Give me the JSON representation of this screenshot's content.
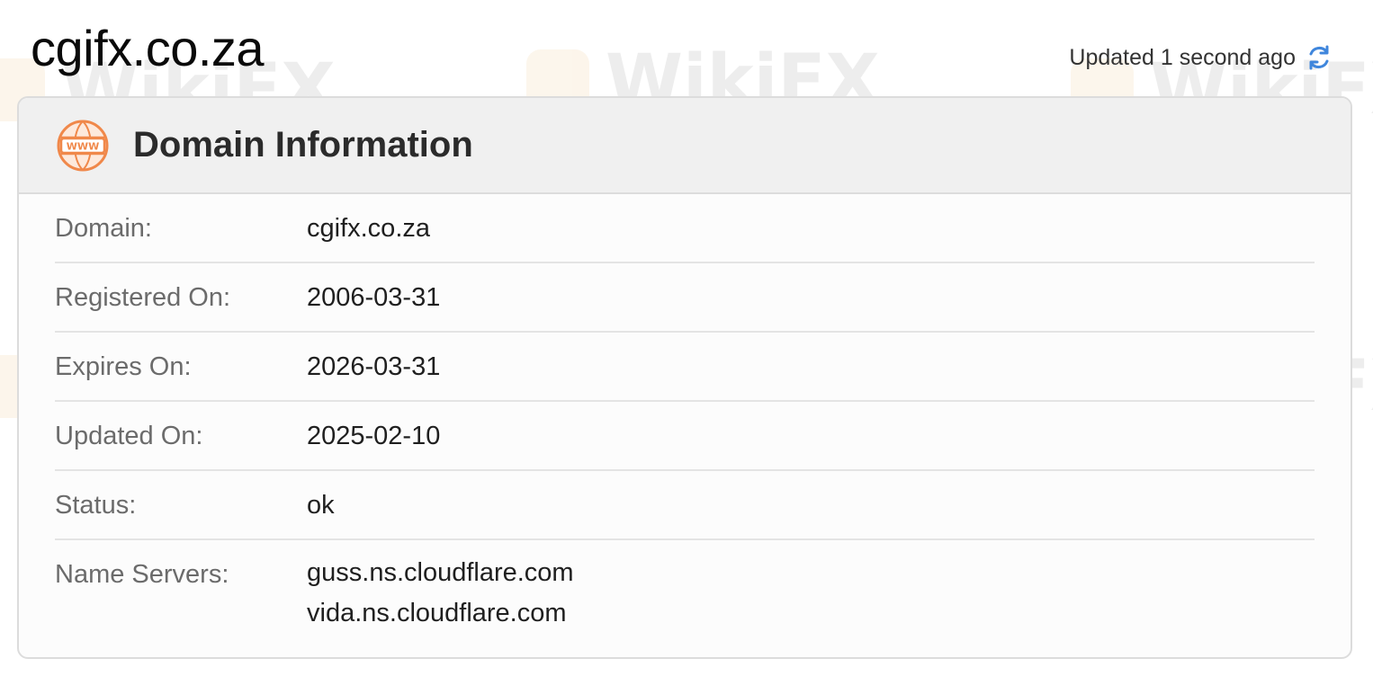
{
  "page": {
    "title": "cgifx.co.za",
    "updated_text": "Updated 1 second ago"
  },
  "watermark": {
    "text": "WikiFX"
  },
  "card": {
    "title": "Domain Information",
    "icon": "www-icon",
    "rows": [
      {
        "label": "Domain:",
        "value": "cgifx.co.za"
      },
      {
        "label": "Registered On:",
        "value": "2006-03-31"
      },
      {
        "label": "Expires On:",
        "value": "2026-03-31"
      },
      {
        "label": "Updated On:",
        "value": "2025-02-10"
      },
      {
        "label": "Status:",
        "value": "ok"
      }
    ],
    "name_servers": {
      "label": "Name Servers:",
      "values": [
        "guss.ns.cloudflare.com",
        "vida.ns.cloudflare.com"
      ]
    }
  },
  "colors": {
    "icon_orange": "#f0884a",
    "refresh_blue": "#3f86dc"
  }
}
